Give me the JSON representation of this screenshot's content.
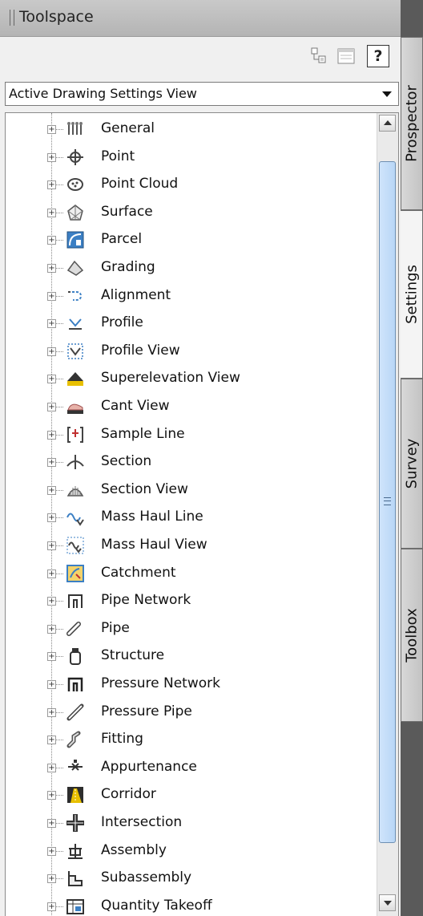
{
  "title": "Toolspace",
  "toolbar": {
    "help_label": "?"
  },
  "view_selector": {
    "selected": "Active Drawing Settings View"
  },
  "tree_items": [
    {
      "label": "General",
      "icon": "general-icon"
    },
    {
      "label": "Point",
      "icon": "point-icon"
    },
    {
      "label": "Point Cloud",
      "icon": "point-cloud-icon"
    },
    {
      "label": "Surface",
      "icon": "surface-icon"
    },
    {
      "label": "Parcel",
      "icon": "parcel-icon"
    },
    {
      "label": "Grading",
      "icon": "grading-icon"
    },
    {
      "label": "Alignment",
      "icon": "alignment-icon"
    },
    {
      "label": "Profile",
      "icon": "profile-icon"
    },
    {
      "label": "Profile View",
      "icon": "profile-view-icon"
    },
    {
      "label": "Superelevation View",
      "icon": "superelevation-view-icon"
    },
    {
      "label": "Cant View",
      "icon": "cant-view-icon"
    },
    {
      "label": "Sample Line",
      "icon": "sample-line-icon"
    },
    {
      "label": "Section",
      "icon": "section-icon"
    },
    {
      "label": "Section View",
      "icon": "section-view-icon"
    },
    {
      "label": "Mass Haul Line",
      "icon": "mass-haul-line-icon"
    },
    {
      "label": "Mass Haul View",
      "icon": "mass-haul-view-icon"
    },
    {
      "label": "Catchment",
      "icon": "catchment-icon"
    },
    {
      "label": "Pipe Network",
      "icon": "pipe-network-icon"
    },
    {
      "label": "Pipe",
      "icon": "pipe-icon"
    },
    {
      "label": "Structure",
      "icon": "structure-icon"
    },
    {
      "label": "Pressure Network",
      "icon": "pressure-network-icon"
    },
    {
      "label": "Pressure Pipe",
      "icon": "pressure-pipe-icon"
    },
    {
      "label": "Fitting",
      "icon": "fitting-icon"
    },
    {
      "label": "Appurtenance",
      "icon": "appurtenance-icon"
    },
    {
      "label": "Corridor",
      "icon": "corridor-icon"
    },
    {
      "label": "Intersection",
      "icon": "intersection-icon"
    },
    {
      "label": "Assembly",
      "icon": "assembly-icon"
    },
    {
      "label": "Subassembly",
      "icon": "subassembly-icon"
    },
    {
      "label": "Quantity Takeoff",
      "icon": "quantity-takeoff-icon"
    }
  ],
  "side_tabs": [
    {
      "label": "Prospector",
      "active": false
    },
    {
      "label": "Settings",
      "active": true
    },
    {
      "label": "Survey",
      "active": false
    },
    {
      "label": "Toolbox",
      "active": false
    }
  ],
  "colors": {
    "title_bar": "#bdbdbd",
    "tree_bg": "#ffffff",
    "scroll_thumb": "#c4dcf6"
  }
}
